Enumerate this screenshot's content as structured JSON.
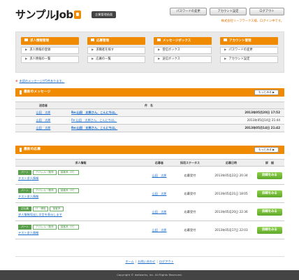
{
  "header": {
    "logo_text": "サンプルJob",
    "badge": "企業管理画面",
    "buttons": [
      "パスワードの変更",
      "アカウント設定",
      "ログアウト"
    ],
    "welcome": "株式会社リーフワークス様、ログイン中です。"
  },
  "menu": [
    {
      "title": "求人情報管理",
      "items": [
        "求人情報の登録",
        "求人情報の一覧"
      ]
    },
    {
      "title": "応募管理",
      "items": [
        "求職者を探す",
        "応募の一覧"
      ]
    },
    {
      "title": "メッセージボックス",
      "items": [
        "受信ボックス",
        "送信ボックス"
      ]
    },
    {
      "title": "アカウント管理",
      "items": [
        "パスワードの変更",
        "アカウント設定"
      ]
    }
  ],
  "notice": "未読のメッセージが5件あります。",
  "messages": {
    "title": "最新のメッセージ",
    "more": "もっとみる",
    "headers": [
      "送信者",
      "件　名",
      ""
    ],
    "rows": [
      {
        "sender": "山田　太郎",
        "subject": "Re:山田　太郎さん、こんにちは。",
        "date": "2013年05月20日 17:52",
        "unread": true
      },
      {
        "sender": "山田　太郎",
        "subject": "Re:山田　太郎さん、こんにちは。",
        "date": "2013年05月14日 21:44",
        "unread": false
      },
      {
        "sender": "山田　太郎",
        "subject": "Re:山田　太郎さん、こんにちは。",
        "date": "2013年05月14日 21:42",
        "unread": true
      }
    ]
  },
  "applications": {
    "title": "最新の応募",
    "more": "もっとみる",
    "headers": [
      "求人情報",
      "応募者",
      "採用ステータス",
      "応募日時",
      "詳　細"
    ],
    "detail_label": "詳細をみる",
    "rows": [
      {
        "tags": [
          "パート",
          "アパレル・販売",
          "接客系（IT）"
        ],
        "job": "テスト求人情報",
        "applicant": "山田　太郎",
        "status": "応募受付",
        "date": "2013年05月22日 20:34"
      },
      {
        "tags": [
          "パート",
          "アパレル・販売",
          "接客系（IT）"
        ],
        "job": "テスト求人情報",
        "applicant": "山田　太郎",
        "status": "応募受付",
        "date": "2013年05月21日 18:05"
      },
      {
        "tags": [
          "正社員",
          "IT・通信",
          "接客系"
        ],
        "job": "求人情報見出し文言を表示します",
        "applicant": "山田　太郎",
        "status": "応募受付",
        "date": "2013年05月20日 22:36"
      },
      {
        "tags": [
          "パート",
          "アパレル・販売",
          "接客系（IT）"
        ],
        "job": "テスト求人情報",
        "applicant": "山田　太郎",
        "status": "応募受付",
        "date": "2013年05月17日 22:03"
      }
    ]
  },
  "footer": {
    "links": [
      "ホーム",
      "お問い合わせ",
      "ログアウト"
    ],
    "separator": "|",
    "copyright": "Copyright © leafworks, Inc. All Rights Reserved."
  }
}
